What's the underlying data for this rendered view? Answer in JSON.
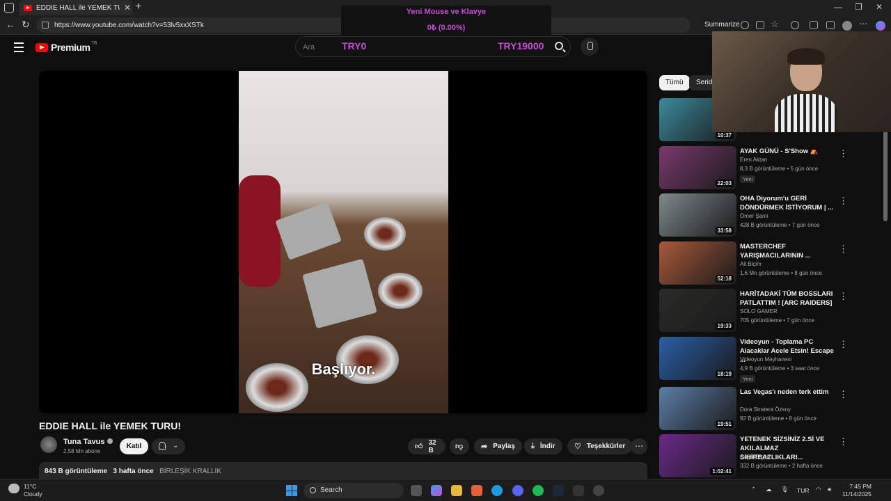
{
  "browser": {
    "tab_title": "EDDIE HALL ile YEMEK TURU! - Yo",
    "url": "https://www.youtube.com/watch?v=53lv5xxXSTk",
    "summarize_label": "Summarize"
  },
  "overlay": {
    "goal_title": "Yeni Mouse ve Klavye",
    "goal_progress": "0₺ (0.00%)",
    "goal_start": "TRY0",
    "goal_end": "TRY19000"
  },
  "header": {
    "logo_text": "Premium",
    "logo_region": "TR",
    "search_placeholder": "Ara"
  },
  "video": {
    "caption": "Başlıyor.",
    "title": "EDDIE HALL ile YEMEK TURU!",
    "channel": "Tuna Tavus",
    "subscribers": "2,58 Mn abone",
    "join_label": "Katıl",
    "likes": "32 B",
    "share_label": "Paylaş",
    "download_label": "İndir",
    "thanks_label": "Teşekkürler",
    "views": "843 B görüntüleme",
    "published": "3 hafta önce",
    "location": "BİRLEŞİK KRALLIK"
  },
  "chips": [
    "Tümü",
    "Seride"
  ],
  "recommendations": [
    {
      "title": "",
      "channel": "",
      "meta": "",
      "duration": "10:37",
      "badge": "",
      "thumb_color": "#3c8a9c"
    },
    {
      "title": "AYAK GÜNÜ - S'Show ⛺",
      "channel": "Eren Aktan",
      "meta": "8,3 B görüntüleme • 5 gün önce",
      "duration": "22:03",
      "badge": "Yeni",
      "thumb_color": "#7a3a6e"
    },
    {
      "title": "OHA Diyorum'u GERİ DÖNDÜRMEK İSTİYORUM | ...",
      "channel": "Ömer Şanlı",
      "meta": "428 B görüntüleme • 7 gün önce",
      "duration": "33:58",
      "badge": "",
      "thumb_color": "#7e8a8a"
    },
    {
      "title": "MASTERCHEF YARIŞMACILARININ ...",
      "channel": "Ali Biçim",
      "meta": "1,6 Mn görüntüleme • 8 gün önce",
      "duration": "52:18",
      "badge": "",
      "thumb_color": "#a85a3a"
    },
    {
      "title": "HARİTADAKİ TÜM BOSSLARI PATLATTIM ! [ARC RAIDERS]",
      "channel": "SOLO GAMER",
      "meta": "705 görüntüleme • 7 gün önce",
      "duration": "19:33",
      "badge": "",
      "thumb_color": "#2a2a28"
    },
    {
      "title": "Videoyun - Toplama PC Alacaklar Acele Etsin! Escape ...",
      "channel": "Videoyun Meyhanesi",
      "meta": "4,9 B görüntüleme • 3 saat önce",
      "duration": "18:19",
      "badge": "Yeni",
      "thumb_color": "#2a5fa8"
    },
    {
      "title": "Las Vegas'ı neden terk ettim",
      "channel": "Dora Stratera Özsoy",
      "meta": "92 B görüntüleme • 8 gün önce",
      "duration": "19:51",
      "badge": "",
      "thumb_color": "#5c7fa8"
    },
    {
      "title": "YETENEK SİZSİNİZ 2.Sİ VE AKILALMAZ SİHİRBAZLIKLARI...",
      "channel": "Çağrı Ergün",
      "meta": "332 B görüntüleme • 2 hafta önce",
      "duration": "1:02:41",
      "badge": "",
      "thumb_color": "#6a2a8a"
    }
  ],
  "taskbar": {
    "temp": "11°C",
    "weather": "Cloudy",
    "search_label": "Search",
    "language": "TUR",
    "time": "7:45 PM",
    "date": "11/14/2025"
  }
}
